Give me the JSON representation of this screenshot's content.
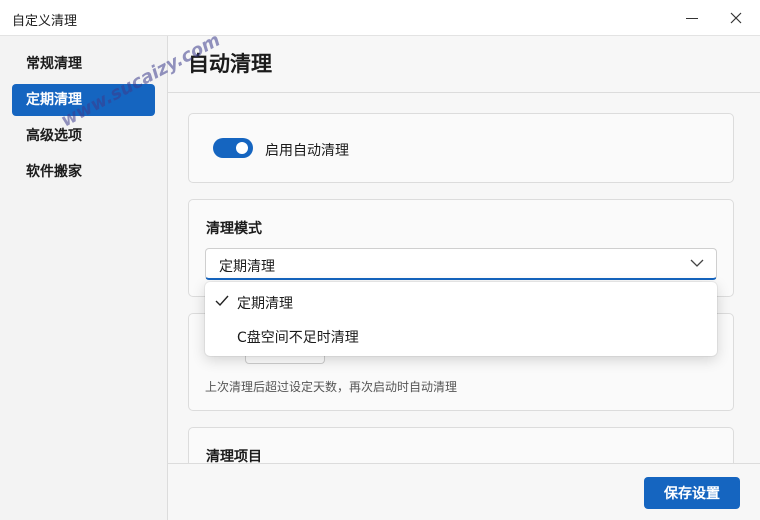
{
  "window": {
    "title": "自定义清理"
  },
  "sidebar": {
    "items": [
      {
        "label": "常规清理",
        "active": false
      },
      {
        "label": "定期清理",
        "active": true
      },
      {
        "label": "高级选项",
        "active": false
      },
      {
        "label": "软件搬家",
        "active": false
      }
    ]
  },
  "header": {
    "title": "自动清理"
  },
  "auto_clean": {
    "toggle_label": "启用自动清理",
    "enabled": true
  },
  "mode": {
    "title": "清理模式",
    "selected": "定期清理",
    "options": [
      "定期清理",
      "C盘空间不足时清理"
    ]
  },
  "interval": {
    "hint": "上次清理后超过设定天数，再次启动时自动清理"
  },
  "items_section": {
    "title": "清理项目"
  },
  "footer": {
    "save_label": "保存设置"
  },
  "watermark": "www.sucaizy.com",
  "colors": {
    "accent": "#1565c0"
  }
}
